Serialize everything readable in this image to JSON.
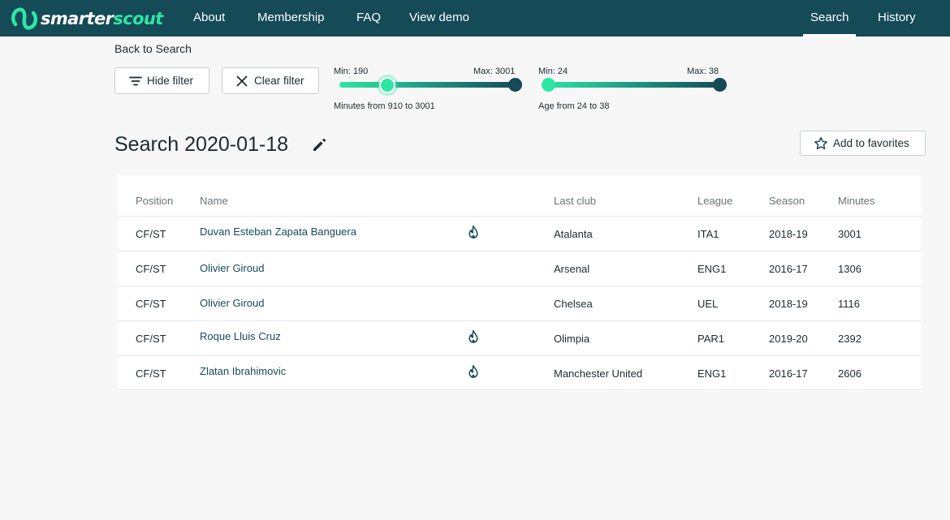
{
  "nav": {
    "logo": {
      "part1": "smarter",
      "part2": "scout"
    },
    "links": [
      "About",
      "Membership",
      "FAQ",
      "View demo"
    ],
    "right_links": [
      "Search",
      "History"
    ],
    "active": "Search"
  },
  "back_link": "Back to Search",
  "buttons": {
    "hide_filter": "Hide filter",
    "clear_filter": "Clear filter",
    "add_favorites": "Add to favorites"
  },
  "sliders": {
    "minutes": {
      "min_label": "Min: 190",
      "max_label": "Max: 3001",
      "caption": "Minutes from 910 to 3001",
      "min": 190,
      "max": 3001,
      "low": 910,
      "high": 3001
    },
    "age": {
      "min_label": "Min: 24",
      "max_label": "Max: 38",
      "caption": "Age from 24 to 38",
      "min": 24,
      "max": 38,
      "low": 24,
      "high": 38
    }
  },
  "title": "Search 2020-01-18",
  "table": {
    "headers": [
      "Position",
      "Name",
      "Last club",
      "League",
      "Season",
      "Minutes"
    ],
    "rows": [
      {
        "position": "CF/ST",
        "name": "Duvan Esteban Zapata Banguera",
        "hot": true,
        "club": "Atalanta",
        "league": "ITA1",
        "season": "2018-19",
        "minutes": "3001"
      },
      {
        "position": "CF/ST",
        "name": "Olivier Giroud",
        "hot": false,
        "club": "Arsenal",
        "league": "ENG1",
        "season": "2016-17",
        "minutes": "1306"
      },
      {
        "position": "CF/ST",
        "name": "Olivier Giroud",
        "hot": false,
        "club": "Chelsea",
        "league": "UEL",
        "season": "2018-19",
        "minutes": "1116"
      },
      {
        "position": "CF/ST",
        "name": "Roque Lluis Cruz",
        "hot": true,
        "club": "Olimpia",
        "league": "PAR1",
        "season": "2019-20",
        "minutes": "2392"
      },
      {
        "position": "CF/ST",
        "name": "Zlatan Ibrahimovic",
        "hot": true,
        "club": "Manchester United",
        "league": "ENG1",
        "season": "2016-17",
        "minutes": "2606"
      }
    ]
  },
  "colors": {
    "nav_bg": "#154a57",
    "accent": "#2ee6a3",
    "link": "#154a57"
  },
  "icons": {
    "filter": "filter-lines-icon",
    "clear": "close-icon",
    "favorite": "star-outline-icon",
    "edit": "pencil-icon",
    "hot": "flame-icon"
  }
}
